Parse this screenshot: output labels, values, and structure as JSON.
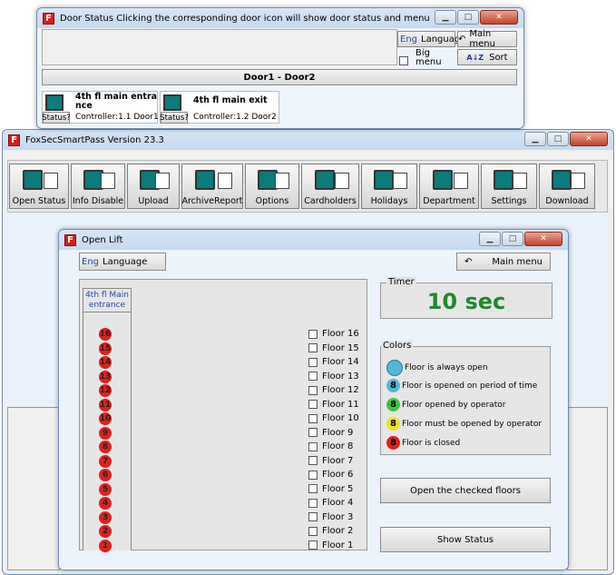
{
  "door_window": {
    "title": "Door Status Clicking the corresponding door icon will show door status and menu",
    "eng": "Eng",
    "language_label": "Language",
    "main_menu_label": "Main menu",
    "big_menu_label": "Big menu",
    "sort_label": "Sort",
    "group_label": "Door1 - Door2",
    "doors": [
      {
        "name": "4th fl main entra nce",
        "status": "Status?",
        "controller": "Controller:1.1 Door1"
      },
      {
        "name": "4th fl main exit",
        "status": "Status?",
        "controller": "Controller:1.2 Door2"
      }
    ]
  },
  "main_window": {
    "title": "FoxSecSmartPass  Version 23.3",
    "toolbar": [
      {
        "label": "Open  Status",
        "icon": "open-status-icon"
      },
      {
        "label": "Info Disable",
        "icon": "info-disable-icon"
      },
      {
        "label": "Upload",
        "icon": "upload-icon"
      },
      {
        "label": "ArchiveReport",
        "icon": "archive-report-icon"
      },
      {
        "label": "Options",
        "icon": "gear-icon"
      },
      {
        "label": "Cardholders",
        "icon": "cardholders-icon"
      },
      {
        "label": "Holidays",
        "icon": "holidays-icon"
      },
      {
        "label": "Department",
        "icon": "department-icon"
      },
      {
        "label": "Settings",
        "icon": "settings-icon"
      },
      {
        "label": "Download",
        "icon": "download-icon"
      }
    ]
  },
  "lift_window": {
    "title": "Open Lift",
    "eng": "Eng",
    "language_label": "Language",
    "main_menu_label": "Main menu",
    "door_tab": "4th fl Main entrance",
    "timer_label": "Timer",
    "timer_value": "10 sec",
    "colors_label": "Colors",
    "legend": [
      {
        "text": "Floor is always open",
        "color": "#4fb8d8",
        "num": ""
      },
      {
        "text": "Floor is opened on period of time",
        "color": "#4fb8d8",
        "num": "8"
      },
      {
        "text": "Floor opened by operator",
        "color": "#3cc83c",
        "num": "8"
      },
      {
        "text": "Floor must be opened by operator",
        "color": "#f2e21c",
        "num": "8"
      },
      {
        "text": "Floor is closed",
        "color": "#e21e1e",
        "num": "8"
      }
    ],
    "open_checked_label": "Open the checked floors",
    "show_status_label": "Show Status",
    "floors": [
      "Floor 16",
      "Floor 15",
      "Floor 14",
      "Floor 13",
      "Floor 12",
      "Floor 11",
      "Floor 10",
      "Floor 9",
      "Floor 8",
      "Floor 7",
      "Floor 6",
      "Floor 5",
      "Floor 4",
      "Floor 3",
      "Floor 2",
      "Floor 1"
    ],
    "floor_numbers": [
      "16",
      "15",
      "14",
      "13",
      "12",
      "11",
      "10",
      "9",
      "8",
      "7",
      "6",
      "5",
      "4",
      "3",
      "2",
      "1"
    ]
  }
}
